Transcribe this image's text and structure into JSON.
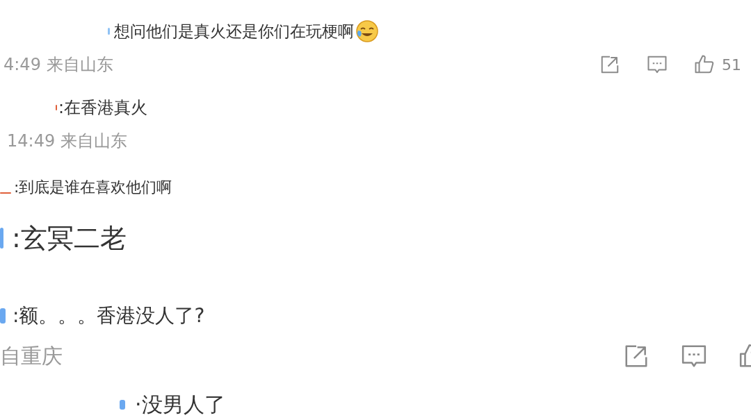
{
  "lines": [
    {
      "kind": "comment",
      "text": "想问他们是真火还是你们在玩梗啊",
      "emoji": true,
      "name_mark": {
        "color": "#8fc2f5"
      }
    },
    {
      "kind": "meta",
      "text": "4:49 来自山东",
      "actions": {
        "share": true,
        "comment": true,
        "like": true,
        "like_count": "51"
      }
    },
    {
      "kind": "comment",
      "text": ":在香港真火",
      "name_mark": {
        "color": "#e0603a"
      }
    },
    {
      "kind": "meta",
      "text": "14:49 来自山东"
    },
    {
      "kind": "comment",
      "text": ":到底是谁在喜欢他们啊",
      "name_mark": {
        "color": "#e0603a"
      }
    },
    {
      "kind": "comment",
      "text": ":玄冥二老",
      "name_mark": {
        "color": "#6aa8f0"
      }
    },
    {
      "kind": "comment",
      "text": ":额。。。香港没人了?",
      "name_mark": {
        "color": "#6aa8f0"
      }
    },
    {
      "kind": "meta",
      "text": "自重庆",
      "actions": {
        "share": true,
        "comment": true,
        "like": true
      }
    },
    {
      "kind": "comment",
      "text": "·没男人了",
      "name_mark": {
        "color": "#6aa8f0"
      }
    }
  ]
}
